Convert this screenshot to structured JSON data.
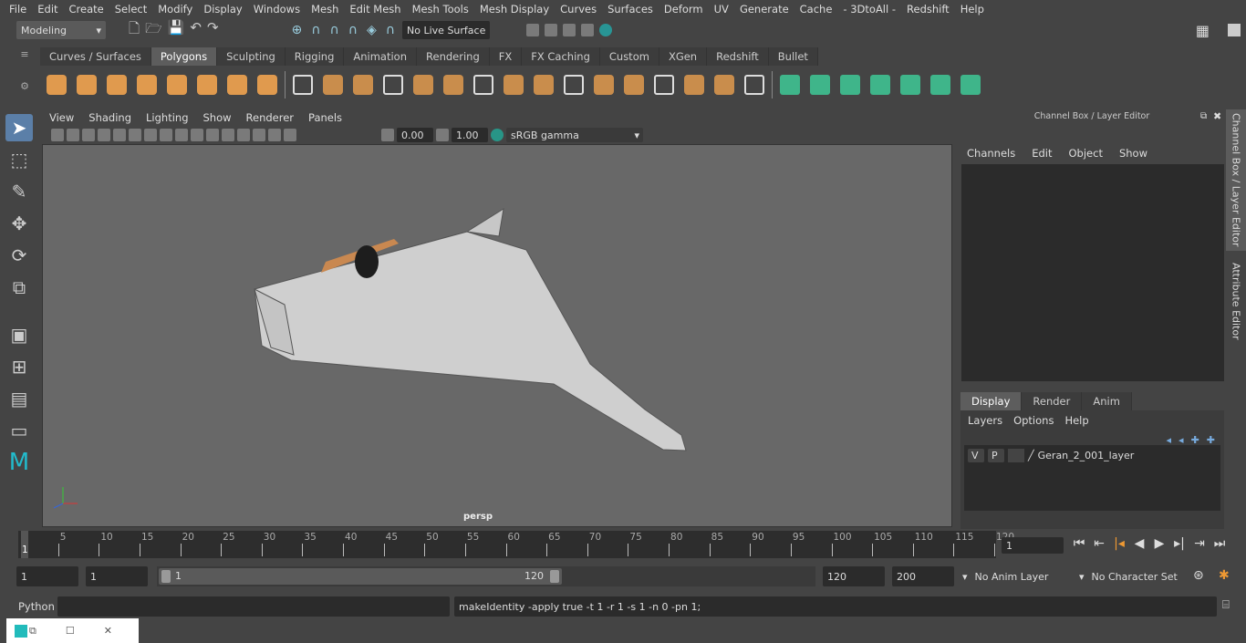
{
  "menu": [
    "File",
    "Edit",
    "Create",
    "Select",
    "Modify",
    "Display",
    "Windows",
    "Mesh",
    "Edit Mesh",
    "Mesh Tools",
    "Mesh Display",
    "Curves",
    "Surfaces",
    "Deform",
    "UV",
    "Generate",
    "Cache",
    "- 3DtoAll -",
    "Redshift",
    "Help"
  ],
  "status": {
    "workspace": "Modeling",
    "live_surface": "No Live Surface"
  },
  "shelf_tabs": [
    "Curves / Surfaces",
    "Polygons",
    "Sculpting",
    "Rigging",
    "Animation",
    "Rendering",
    "FX",
    "FX Caching",
    "Custom",
    "XGen",
    "Redshift",
    "Bullet"
  ],
  "active_shelf_tab": "Polygons",
  "viewport": {
    "menu": [
      "View",
      "Shading",
      "Lighting",
      "Show",
      "Renderer",
      "Panels"
    ],
    "exposure": "0.00",
    "gamma": "1.00",
    "color_space": "sRGB gamma",
    "camera": "persp"
  },
  "channel_box": {
    "title": "Channel Box / Layer Editor",
    "menu": [
      "Channels",
      "Edit",
      "Object",
      "Show"
    ],
    "tabs": [
      "Display",
      "Render",
      "Anim"
    ],
    "active_tab": "Display",
    "layer_menu": [
      "Layers",
      "Options",
      "Help"
    ],
    "layers": [
      {
        "v": "V",
        "p": "P",
        "name": "Geran_2_001_layer"
      }
    ]
  },
  "side_tabs": [
    "Channel Box / Layer Editor",
    "Attribute Editor"
  ],
  "timeline": {
    "ticks": [
      5,
      10,
      15,
      20,
      25,
      30,
      35,
      40,
      45,
      50,
      55,
      60,
      65,
      70,
      75,
      80,
      85,
      90,
      95,
      100,
      105,
      110,
      115,
      120
    ],
    "start_label": "1",
    "current_frame": "1"
  },
  "range": {
    "start": "1",
    "anim_start": "1",
    "slider_start": "1",
    "slider_end": "120",
    "end": "120",
    "anim_end": "200",
    "anim_layer": "No Anim Layer",
    "character_set": "No Character Set"
  },
  "command": {
    "label": "Python",
    "input": "",
    "output": "makeIdentity -apply true -t 1 -r 1 -s 1 -n 0 -pn 1;"
  },
  "colors": {
    "accent": "#e09a4e",
    "viewport_bg": "#686868",
    "active_tab": "#5d5d5d"
  }
}
